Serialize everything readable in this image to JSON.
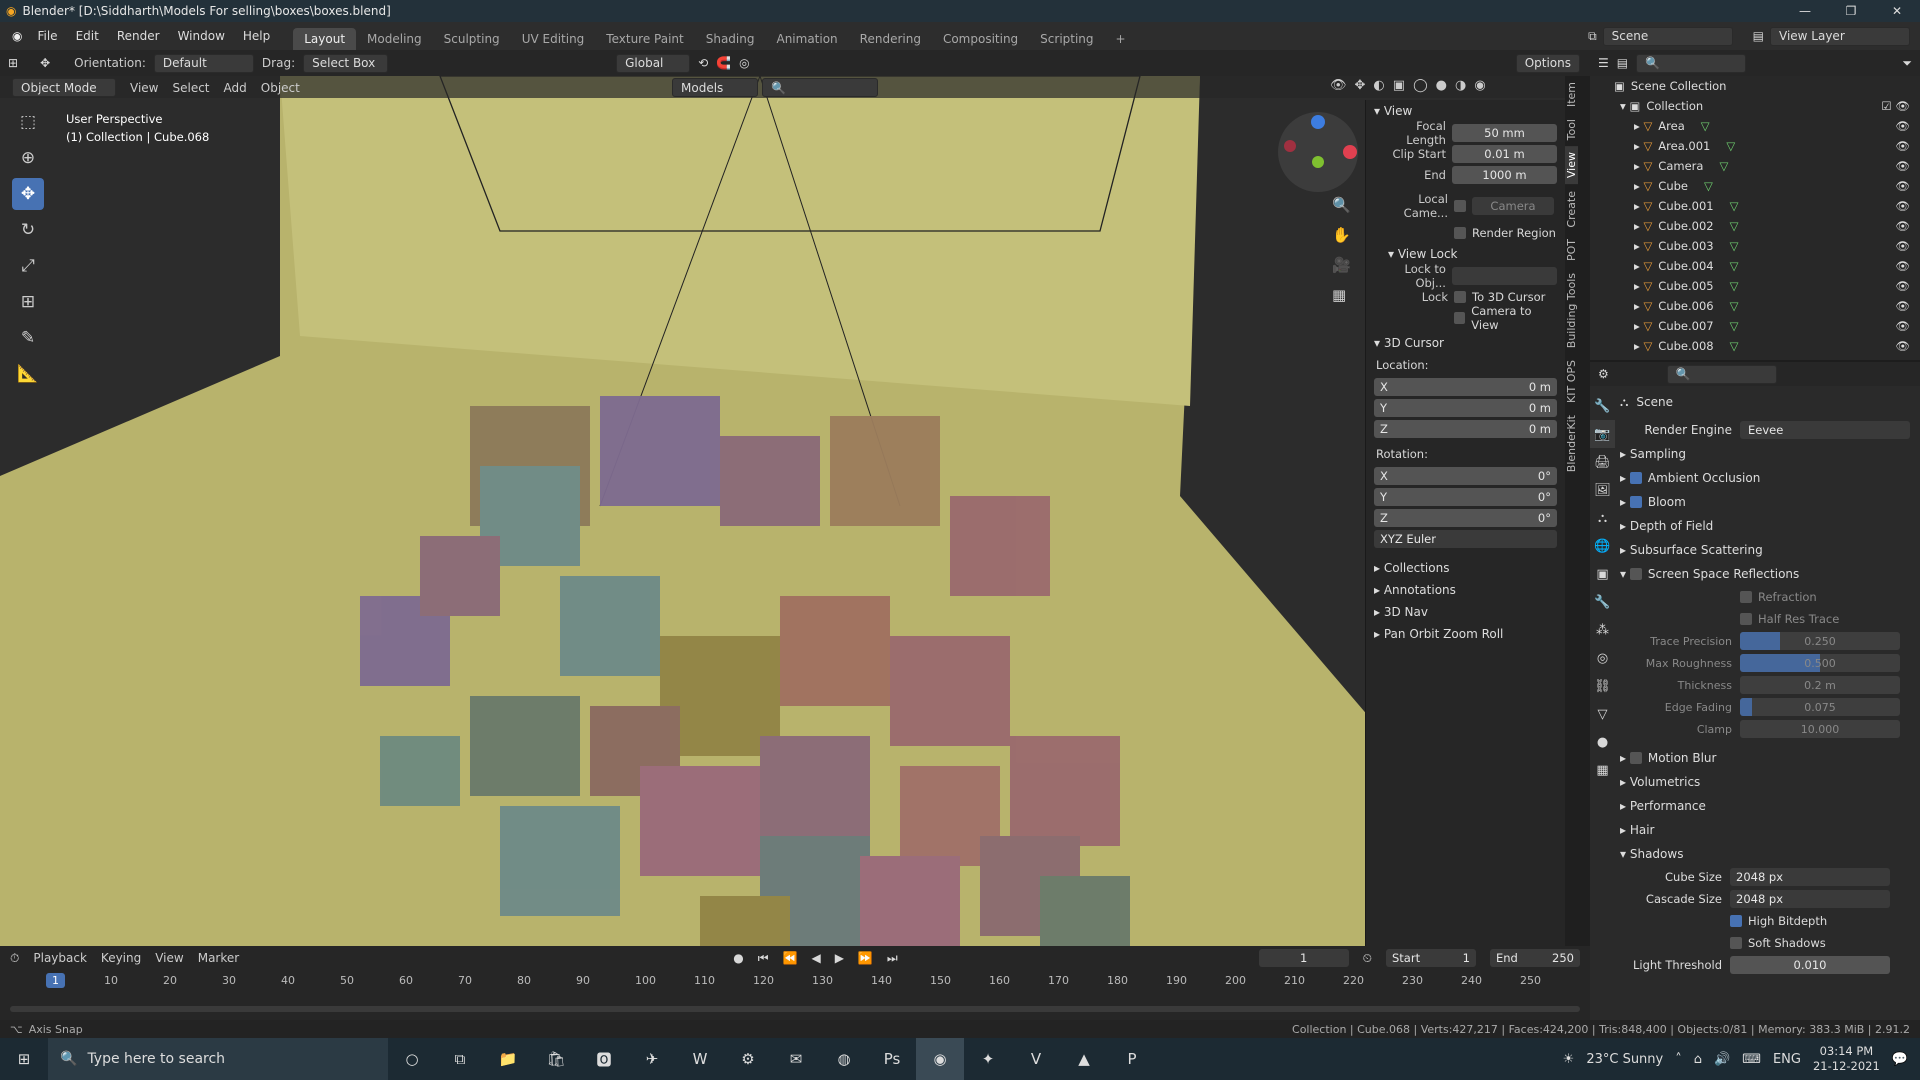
{
  "window": {
    "title": "Blender* [D:\\Siddharth\\Models For selling\\boxes\\boxes.blend]",
    "min": "—",
    "max": "❐",
    "close": "✕"
  },
  "menu": {
    "items": [
      "File",
      "Edit",
      "Render",
      "Window",
      "Help"
    ],
    "workspaces": [
      "Layout",
      "Modeling",
      "Sculpting",
      "UV Editing",
      "Texture Paint",
      "Shading",
      "Animation",
      "Rendering",
      "Compositing",
      "Scripting"
    ],
    "scene": "Scene",
    "view_layer": "View Layer"
  },
  "header": {
    "orientation_label": "Orientation:",
    "orientation": "Default",
    "drag_label": "Drag:",
    "drag": "Select Box",
    "transform": "Global",
    "options": "Options"
  },
  "viewport_header": {
    "mode": "Object Mode",
    "view": "View",
    "select": "Select",
    "add": "Add",
    "object": "Object",
    "collection_filter": "Models"
  },
  "overlay": {
    "perspective": "User Perspective",
    "collection": "(1) Collection | Cube.068"
  },
  "npanel": {
    "view_title": "View",
    "focal_label": "Focal Length",
    "focal": "50 mm",
    "clip_start_label": "Clip Start",
    "clip_start": "0.01 m",
    "end_label": "End",
    "end": "1000 m",
    "local_cam_label": "Local Came...",
    "local_cam": "Camera",
    "render_region": "Render Region",
    "view_lock": "View Lock",
    "lock_obj_label": "Lock to Obj...",
    "lock_label": "Lock",
    "to_cursor": "To 3D Cursor",
    "cam_to_view": "Camera to View",
    "cursor_title": "3D Cursor",
    "location": "Location:",
    "x": "X",
    "y": "Y",
    "z": "Z",
    "loc_x": "0 m",
    "loc_y": "0 m",
    "loc_z": "0 m",
    "rotation": "Rotation:",
    "rot_x": "0°",
    "rot_y": "0°",
    "rot_z": "0°",
    "rot_mode": "XYZ Euler",
    "collections": "Collections",
    "annotations": "Annotations",
    "nav3d": "3D Nav",
    "pan_orbit": "Pan Orbit Zoom Roll"
  },
  "vtabs": [
    "Item",
    "Tool",
    "View",
    "Create",
    "POT",
    "Building Tools",
    "KIT OPS",
    "BlenderKit"
  ],
  "outliner": {
    "root": "Scene Collection",
    "collection": "Collection",
    "items": [
      "Area",
      "Area.001",
      "Camera",
      "Cube",
      "Cube.001",
      "Cube.002",
      "Cube.003",
      "Cube.004",
      "Cube.005",
      "Cube.006",
      "Cube.007",
      "Cube.008"
    ]
  },
  "props": {
    "scene": "Scene",
    "engine_label": "Render Engine",
    "engine": "Eevee",
    "sections": [
      {
        "label": "Sampling",
        "check": null
      },
      {
        "label": "Ambient Occlusion",
        "check": true
      },
      {
        "label": "Bloom",
        "check": true
      },
      {
        "label": "Depth of Field",
        "check": null
      },
      {
        "label": "Subsurface Scattering",
        "check": null
      },
      {
        "label": "Screen Space Reflections",
        "check": false
      }
    ],
    "refraction": "Refraction",
    "half_res": "Half Res Trace",
    "trace_label": "Trace Precision",
    "trace": "0.250",
    "trace_fill": 0.25,
    "roughness_label": "Max Roughness",
    "roughness": "0.500",
    "roughness_fill": 0.5,
    "thickness_label": "Thickness",
    "thickness": "0.2 m",
    "edge_label": "Edge Fading",
    "edge": "0.075",
    "edge_fill": 0.075,
    "clamp_label": "Clamp",
    "clamp": "10.000",
    "motion_blur": "Motion Blur",
    "volumetrics": "Volumetrics",
    "performance": "Performance",
    "hair": "Hair",
    "shadows": "Shadows",
    "cube_size_label": "Cube Size",
    "cube_size": "2048 px",
    "cascade_label": "Cascade Size",
    "cascade": "2048 px",
    "high_bitdepth": "High Bitdepth",
    "soft_shadows": "Soft Shadows",
    "light_thr_label": "Light Threshold",
    "light_thr": "0.010"
  },
  "timeline": {
    "playback": "Playback",
    "keying": "Keying",
    "view": "View",
    "marker": "Marker",
    "current": "1",
    "start_label": "Start",
    "start": "1",
    "end_label": "End",
    "end": "250",
    "ticks": [
      "10",
      "20",
      "30",
      "40",
      "50",
      "60",
      "70",
      "80",
      "90",
      "100",
      "110",
      "120",
      "130",
      "140",
      "150",
      "160",
      "170",
      "180",
      "190",
      "200",
      "210",
      "220",
      "230",
      "240",
      "250"
    ],
    "frame": "1"
  },
  "status": {
    "left": "Axis Snap",
    "right": "Collection | Cube.068 | Verts:427,217 | Faces:424,200 | Tris:848,400 | Objects:0/81 | Memory: 383.3 MiB | 2.91.2"
  },
  "taskbar": {
    "search": "Type here to search",
    "weather": "23°C  Sunny",
    "lang": "ENG",
    "time": "03:14 PM",
    "date": "21-12-2021"
  },
  "colors": {
    "accent": "#4772b3",
    "backdrop": "#b6b26a"
  }
}
